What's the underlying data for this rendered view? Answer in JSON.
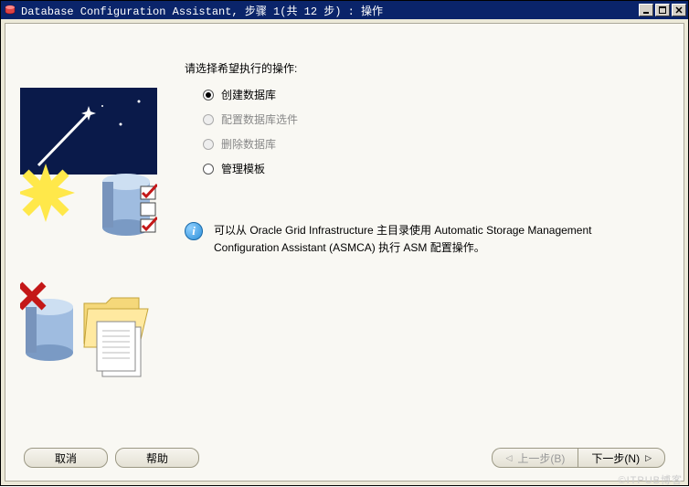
{
  "window": {
    "title": "Database Configuration Assistant, 步骤 1(共 12 步) : 操作"
  },
  "main": {
    "prompt": "请选择希望执行的操作:",
    "options": {
      "create": "创建数据库",
      "configure": "配置数据库选件",
      "delete": "删除数据库",
      "templates": "管理模板"
    },
    "info": "可以从 Oracle Grid Infrastructure 主目录使用 Automatic Storage Management Configuration Assistant (ASMCA) 执行 ASM 配置操作。"
  },
  "buttons": {
    "cancel": "取消",
    "help": "帮助",
    "back": "上一步(B)",
    "next": "下一步(N)"
  },
  "watermark": "©ITPUB博客"
}
